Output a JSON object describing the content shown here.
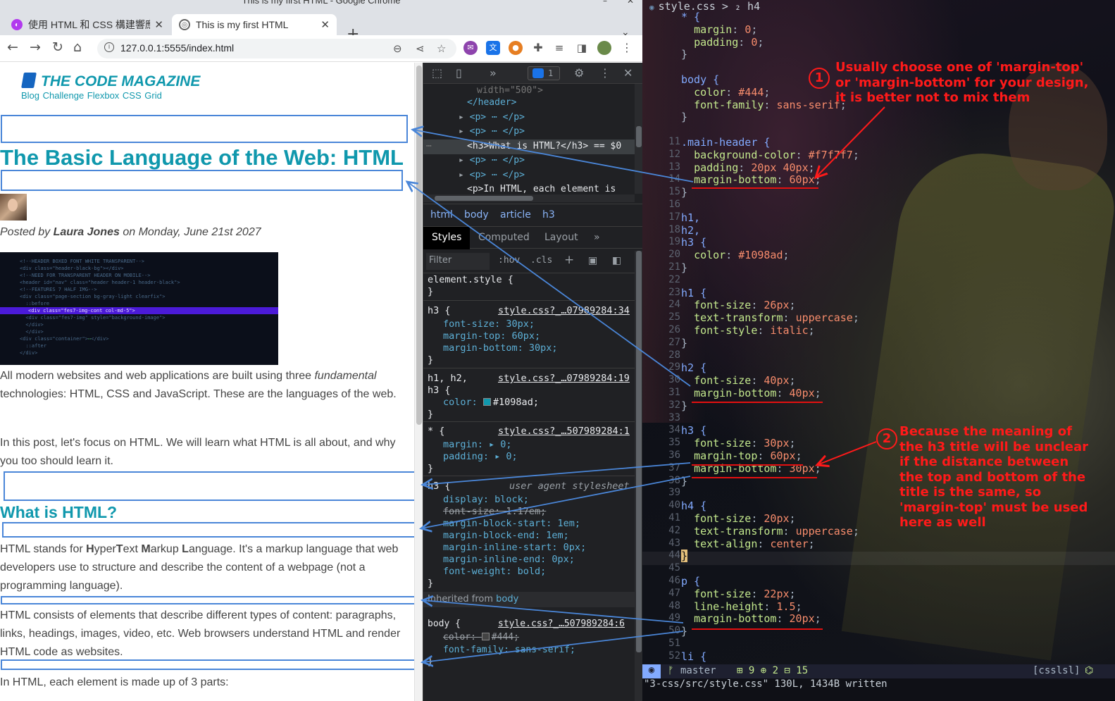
{
  "window": {
    "title": "This is my first HTML - Google Chrome"
  },
  "tabs": [
    {
      "title": "使用 HTML 和 CSS 構建響應"
    },
    {
      "title": "This is my first HTML"
    }
  ],
  "address": {
    "url": "127.0.0.1:5555/index.html"
  },
  "page": {
    "logo": "THE CODE MAGAZINE",
    "nav": "Blog Challenge Flexbox CSS Grid",
    "heading": "The Basic Language of the Web: HTML",
    "posted_prefix": "Posted by",
    "author": "Laura Jones",
    "posted_suffix": "on Monday, June 21st 2027",
    "p1_a": "All modern websites and web applications are built using three",
    "p1_em": "fundamental",
    "p1_b": "technologies: HTML, CSS and JavaScript. These are the languages of the web.",
    "p2": "In this post, let's focus on HTML. We will learn what HTML is all about, and why you too should learn it.",
    "h3": "What is HTML?",
    "p3_html": "HTML stands for <b>H</b>yper<b>T</b>ext <b>M</b>arkup <b>L</b>anguage. It's a markup language that web developers use to structure and describe the content of a webpage (not a programming language).",
    "p4": "HTML consists of elements that describe different types of content: paragraphs, links, headings, images, video, etc. Web browsers understand HTML and render HTML code as websites.",
    "p5": "In HTML, each element is made up of 3 parts:"
  },
  "devtools": {
    "issues_count": "1",
    "dom": [
      "width=\"500\">",
      "</header>",
      "<p> ⋯ </p>",
      "<p> ⋯ </p>",
      "<h3>What is HTML?</h3> == $0",
      "<p> ⋯ </p>",
      "<p> ⋯ </p>",
      "<p>In HTML, each element is"
    ],
    "crumbs": [
      "html",
      "body",
      "article",
      "h3"
    ],
    "tabs": [
      "Styles",
      "Computed",
      "Layout",
      "»"
    ],
    "filter_placeholder": "Filter",
    "hov": ":hov",
    "cls": ".cls",
    "element_style": "element.style {",
    "rule_h3": "h3 {",
    "src_h3": "style.css?_…07989284:34",
    "h3_font_size": "font-size: 30px;",
    "h3_margin_top": "margin-top: 60px;",
    "h3_margin_bottom": "margin-bottom: 30px;",
    "rule_h1h2": "h1, h2,",
    "rule_h3b": "h3 {",
    "src_h1h2": "style.css?_…07989284:19",
    "color_prop": "color:",
    "color_val": "#1098ad;",
    "rule_star": "* {",
    "src_star": "style.css?_…507989284:1",
    "star_margin": "margin: ▸ 0;",
    "star_padding": "padding: ▸ 0;",
    "rule_ua": "h3 {",
    "ua_label": "user agent stylesheet",
    "ua_lines": [
      "display: block;",
      "font-size: 1.17em;",
      "margin-block-start: 1em;",
      "margin-block-end: 1em;",
      "margin-inline-start: 0px;",
      "margin-inline-end: 0px;",
      "font-weight: bold;"
    ],
    "inherited_label": "Inherited from",
    "inherited_tag": "body",
    "rule_body": "body {",
    "src_body": "style.css?_…507989284:6",
    "body_color": "color: ",
    "body_color_val": "#444;",
    "body_font": "font-family: sans-serif;",
    "close_brace": "}"
  },
  "editor": {
    "breadcrumb": "style.css > ₂ h4",
    "lines": [
      {
        "n": "",
        "t": "* {"
      },
      {
        "n": "",
        "t": "  margin: 0;"
      },
      {
        "n": "",
        "t": "  padding: 0;"
      },
      {
        "n": "",
        "t": "}"
      },
      {
        "n": "",
        "t": ""
      },
      {
        "n": "",
        "t": "body {"
      },
      {
        "n": "",
        "t": "  color: #444;"
      },
      {
        "n": "",
        "t": "  font-family: sans-serif;"
      },
      {
        "n": "",
        "t": "}"
      },
      {
        "n": "",
        "t": ""
      },
      {
        "n": "11",
        "t": ".main-header {"
      },
      {
        "n": "12",
        "t": "  background-color: #f7f7f7;"
      },
      {
        "n": "13",
        "t": "  padding: 20px 40px;"
      },
      {
        "n": "14",
        "t": "  margin-bottom: 60px;"
      },
      {
        "n": "15",
        "t": "}"
      },
      {
        "n": "16",
        "t": ""
      },
      {
        "n": "17",
        "t": "h1,"
      },
      {
        "n": "18",
        "t": "h2,"
      },
      {
        "n": "19",
        "t": "h3 {"
      },
      {
        "n": "20",
        "t": "  color: #1098ad;"
      },
      {
        "n": "21",
        "t": "}"
      },
      {
        "n": "22",
        "t": ""
      },
      {
        "n": "23",
        "t": "h1 {"
      },
      {
        "n": "24",
        "t": "  font-size: 26px;"
      },
      {
        "n": "25",
        "t": "  text-transform: uppercase;"
      },
      {
        "n": "26",
        "t": "  font-style: italic;"
      },
      {
        "n": "27",
        "t": "}"
      },
      {
        "n": "28",
        "t": ""
      },
      {
        "n": "29",
        "t": "h2 {"
      },
      {
        "n": "30",
        "t": "  font-size: 40px;"
      },
      {
        "n": "31",
        "t": "  margin-bottom: 40px;"
      },
      {
        "n": "32",
        "t": "}"
      },
      {
        "n": "33",
        "t": ""
      },
      {
        "n": "34",
        "t": "h3 {"
      },
      {
        "n": "35",
        "t": "  font-size: 30px;"
      },
      {
        "n": "36",
        "t": "  margin-top: 60px;"
      },
      {
        "n": "37",
        "t": "  margin-bottom: 30px;"
      },
      {
        "n": "38",
        "t": "}"
      },
      {
        "n": "39",
        "t": ""
      },
      {
        "n": "40",
        "t": "h4 {"
      },
      {
        "n": "41",
        "t": "  font-size: 20px;"
      },
      {
        "n": "42",
        "t": "  text-transform: uppercase;"
      },
      {
        "n": "43",
        "t": "  text-align: center;"
      },
      {
        "n": "44",
        "t": "}"
      },
      {
        "n": "45",
        "t": ""
      },
      {
        "n": "46",
        "t": "p {"
      },
      {
        "n": "47",
        "t": "  font-size: 22px;"
      },
      {
        "n": "48",
        "t": "  line-height: 1.5;"
      },
      {
        "n": "49",
        "t": "  margin-bottom: 20px;"
      },
      {
        "n": "50",
        "t": "}"
      },
      {
        "n": "51",
        "t": ""
      },
      {
        "n": "52",
        "t": "li {"
      }
    ],
    "note1": [
      "Usually choose one of 'margin-top'",
      "or 'margin-bottom' for your design,",
      "it is better not to mix them"
    ],
    "note1_num": "1",
    "note2": [
      "Because the meaning of",
      "the h3 title will be unclear",
      "if the distance between",
      "the top and bottom of the",
      "title is the same, so",
      "'margin-top' must be used",
      "here as well"
    ],
    "note2_num": "2",
    "status_branch": "master",
    "status_counts": "⊞ 9 ⊕ 2 ⊟ 15",
    "status_ft": "[csslsl]",
    "cmdline": "\"3-css/src/style.css\" 130L, 1434B written"
  }
}
